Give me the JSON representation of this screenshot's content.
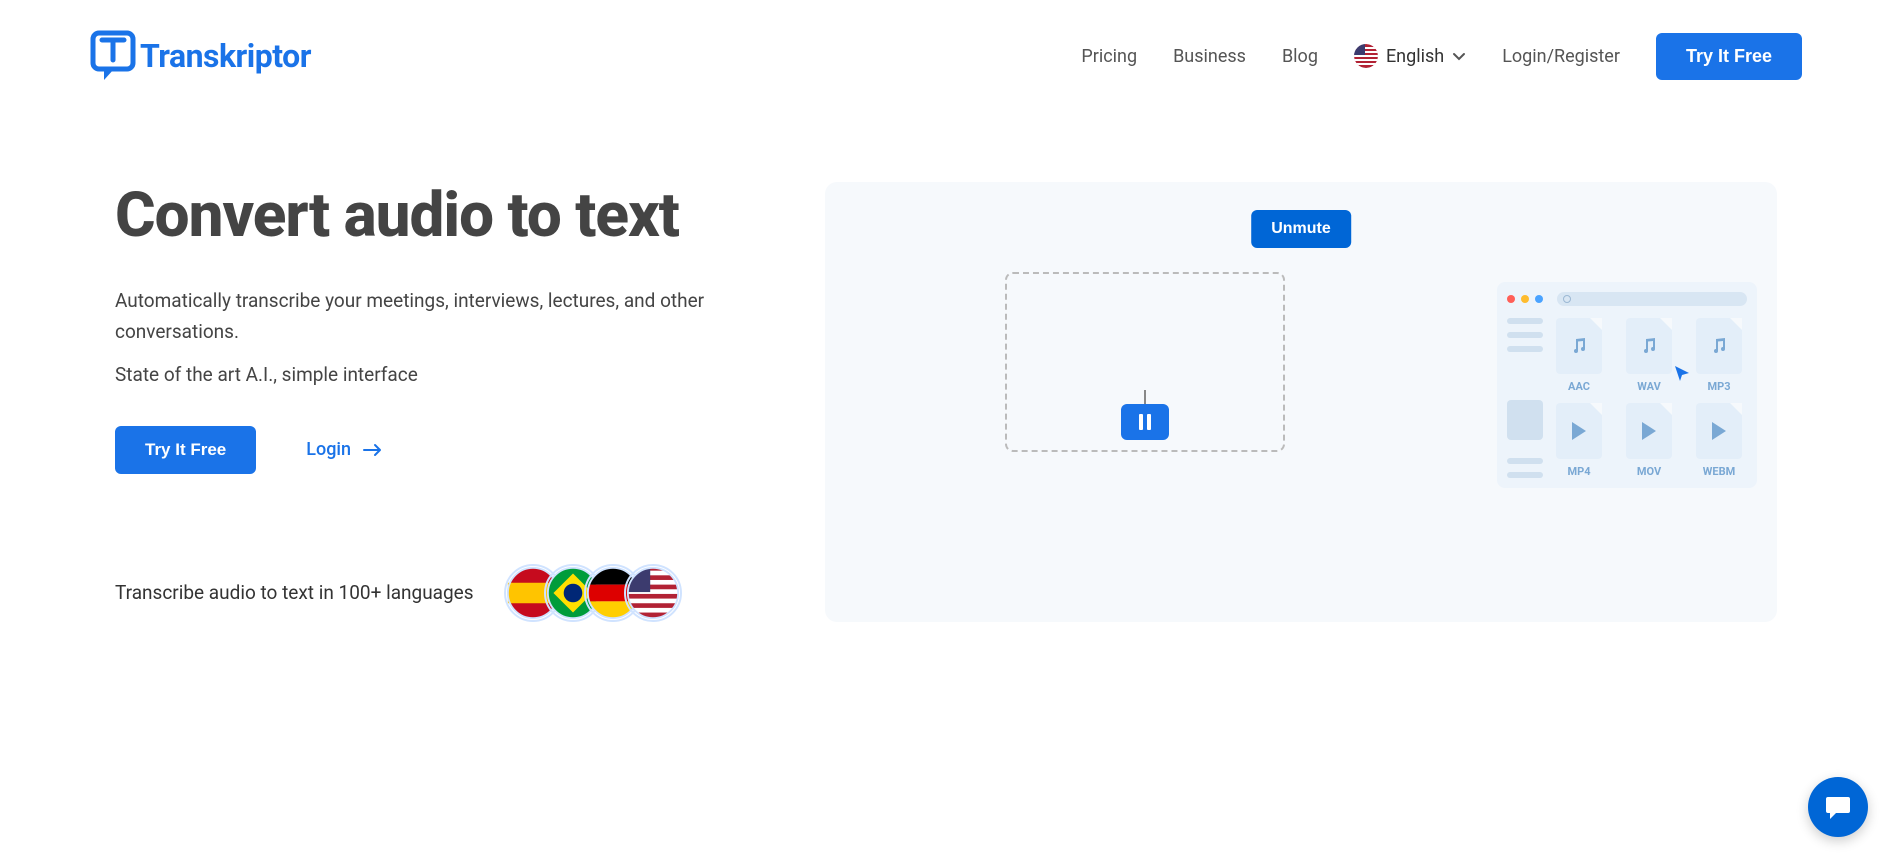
{
  "brand": {
    "name": "Transkriptor"
  },
  "nav": {
    "pricing": "Pricing",
    "business": "Business",
    "blog": "Blog",
    "language_label": "English",
    "login_register": "Login/Register",
    "cta": "Try It Free"
  },
  "hero": {
    "title": "Convert audio to text",
    "desc1": "Automatically transcribe your meetings, interviews, lectures, and other conversations.",
    "desc2": "State of the art A.I., simple interface",
    "cta": "Try It Free",
    "login": "Login",
    "languages_text": "Transcribe audio to text in 100+ languages"
  },
  "media": {
    "unmute": "Unmute",
    "files": [
      {
        "ext": "AAC",
        "kind": "audio"
      },
      {
        "ext": "WAV",
        "kind": "audio"
      },
      {
        "ext": "MP3",
        "kind": "audio"
      },
      {
        "ext": "MP4",
        "kind": "video"
      },
      {
        "ext": "MOV",
        "kind": "video"
      },
      {
        "ext": "WEBM",
        "kind": "video"
      }
    ]
  }
}
